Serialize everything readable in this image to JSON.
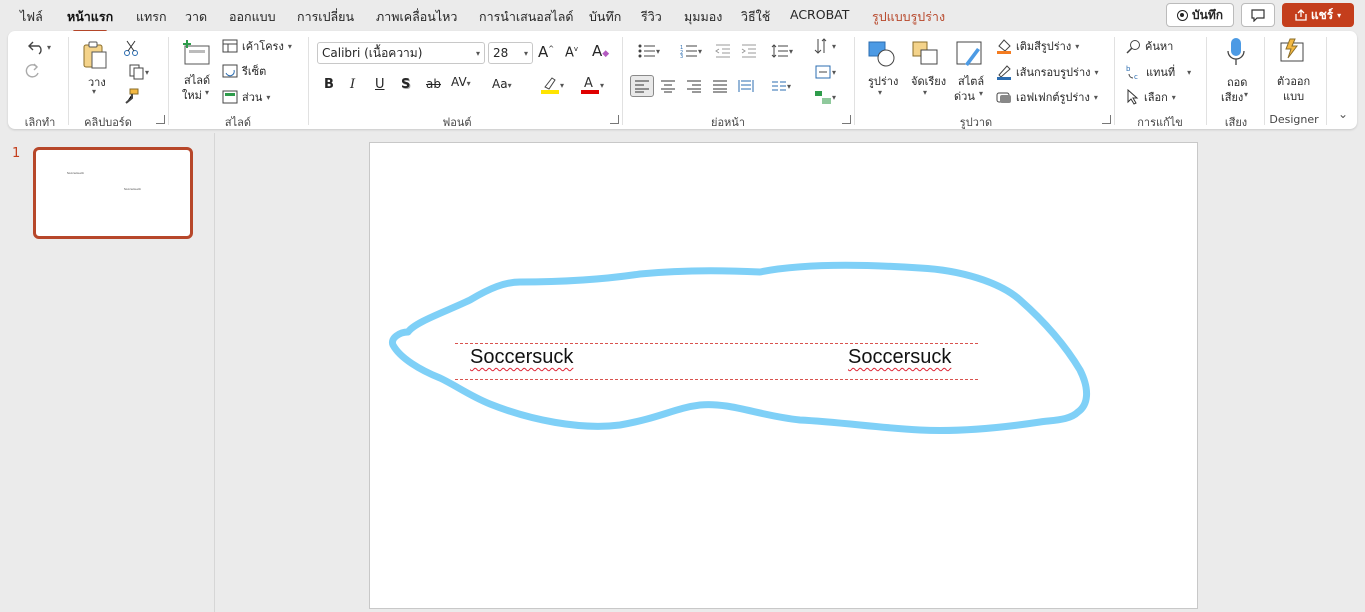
{
  "menu": {
    "tabs": [
      "ไฟล์",
      "หน้าแรก",
      "แทรก",
      "วาด",
      "ออกแบบ",
      "การเปลี่ยน",
      "ภาพเคลื่อนไหว",
      "การนำเสนอสไลด์",
      "บันทึก",
      "รีวิว",
      "มุมมอง",
      "วิธีใช้",
      "ACROBAT",
      "รูปแบบรูปร่าง"
    ],
    "active_tab": "หน้าแรก",
    "record_label": "บันทึก",
    "share_label": "แชร์"
  },
  "ribbon": {
    "undo": {
      "group": "เลิกทำ"
    },
    "clipboard": {
      "group": "คลิปบอร์ด",
      "paste": "วาง"
    },
    "slides": {
      "group": "สไลด์",
      "new_slide_1": "สไลด์",
      "new_slide_2": "ใหม่",
      "layout": "เค้าโครง",
      "reset": "รีเซ็ต",
      "section": "ส่วน"
    },
    "font": {
      "group": "ฟอนต์",
      "font_name": "Calibri (เนื้อความ)",
      "font_size": "28"
    },
    "paragraph": {
      "group": "ย่อหน้า"
    },
    "drawing": {
      "group": "รูปวาด",
      "shapes": "รูปร่าง",
      "arrange": "จัดเรียง",
      "quick_styles_1": "สไตล์",
      "quick_styles_2": "ด่วน",
      "fill": "เติมสีรูปร่าง",
      "outline": "เส้นกรอบรูปร่าง",
      "effects": "เอฟเฟกต์รูปร่าง"
    },
    "editing": {
      "group": "การแก้ไข",
      "find": "ค้นหา",
      "replace": "แทนที่",
      "select": "เลือก"
    },
    "voice": {
      "group": "เสียง",
      "dictate_1": "ถอด",
      "dictate_2": "เสียง"
    },
    "designer": {
      "group": "Designer",
      "label_1": "ตัวออก",
      "label_2": "แบบ"
    }
  },
  "thumbnails": [
    {
      "number": "1",
      "text_1": "Soccersuck",
      "text_2": "Soccersuck"
    }
  ],
  "slide": {
    "text_left": "Soccersuck",
    "text_right": "Soccersuck"
  },
  "colors": {
    "accent": "#c43e1c",
    "ink": "#7fd0f7",
    "highlight": "#ffe400",
    "font_color": "#e00000"
  }
}
